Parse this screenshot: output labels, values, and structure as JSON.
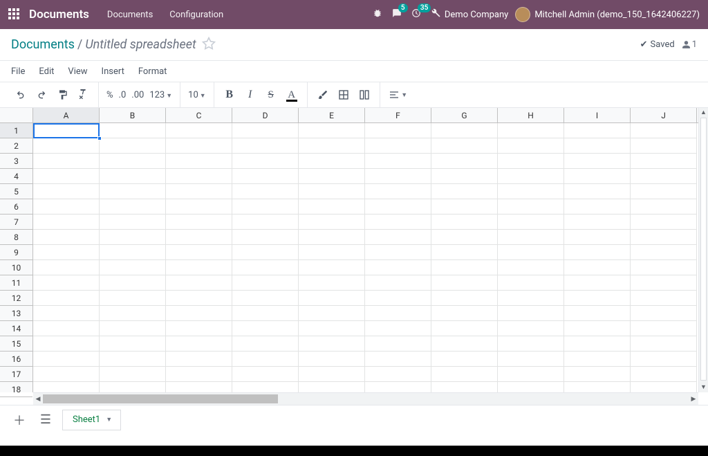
{
  "topnav": {
    "app_title": "Documents",
    "links": [
      "Documents",
      "Configuration"
    ],
    "badges": {
      "messages": "5",
      "activities": "35"
    },
    "company": "Demo Company",
    "user": "Mitchell Admin (demo_150_1642406227)"
  },
  "breadcrumb": {
    "root": "Documents",
    "separator": "/",
    "current": "Untitled spreadsheet",
    "saved_label": "Saved",
    "collab_count": "1"
  },
  "menubar": [
    "File",
    "Edit",
    "View",
    "Insert",
    "Format"
  ],
  "toolbar": {
    "number_fmt": {
      "percent": "%",
      "dec_dec": ".0",
      "inc_dec": ".00",
      "more": "123"
    },
    "font_size": "10"
  },
  "grid": {
    "columns": [
      "A",
      "B",
      "C",
      "D",
      "E",
      "F",
      "G",
      "H",
      "I",
      "J"
    ],
    "rows": [
      "1",
      "2",
      "3",
      "4",
      "5",
      "6",
      "7",
      "8",
      "9",
      "10",
      "11",
      "12",
      "13",
      "14",
      "15",
      "16",
      "17",
      "18"
    ],
    "active_cell": "A1"
  },
  "sheets": {
    "active": "Sheet1"
  }
}
